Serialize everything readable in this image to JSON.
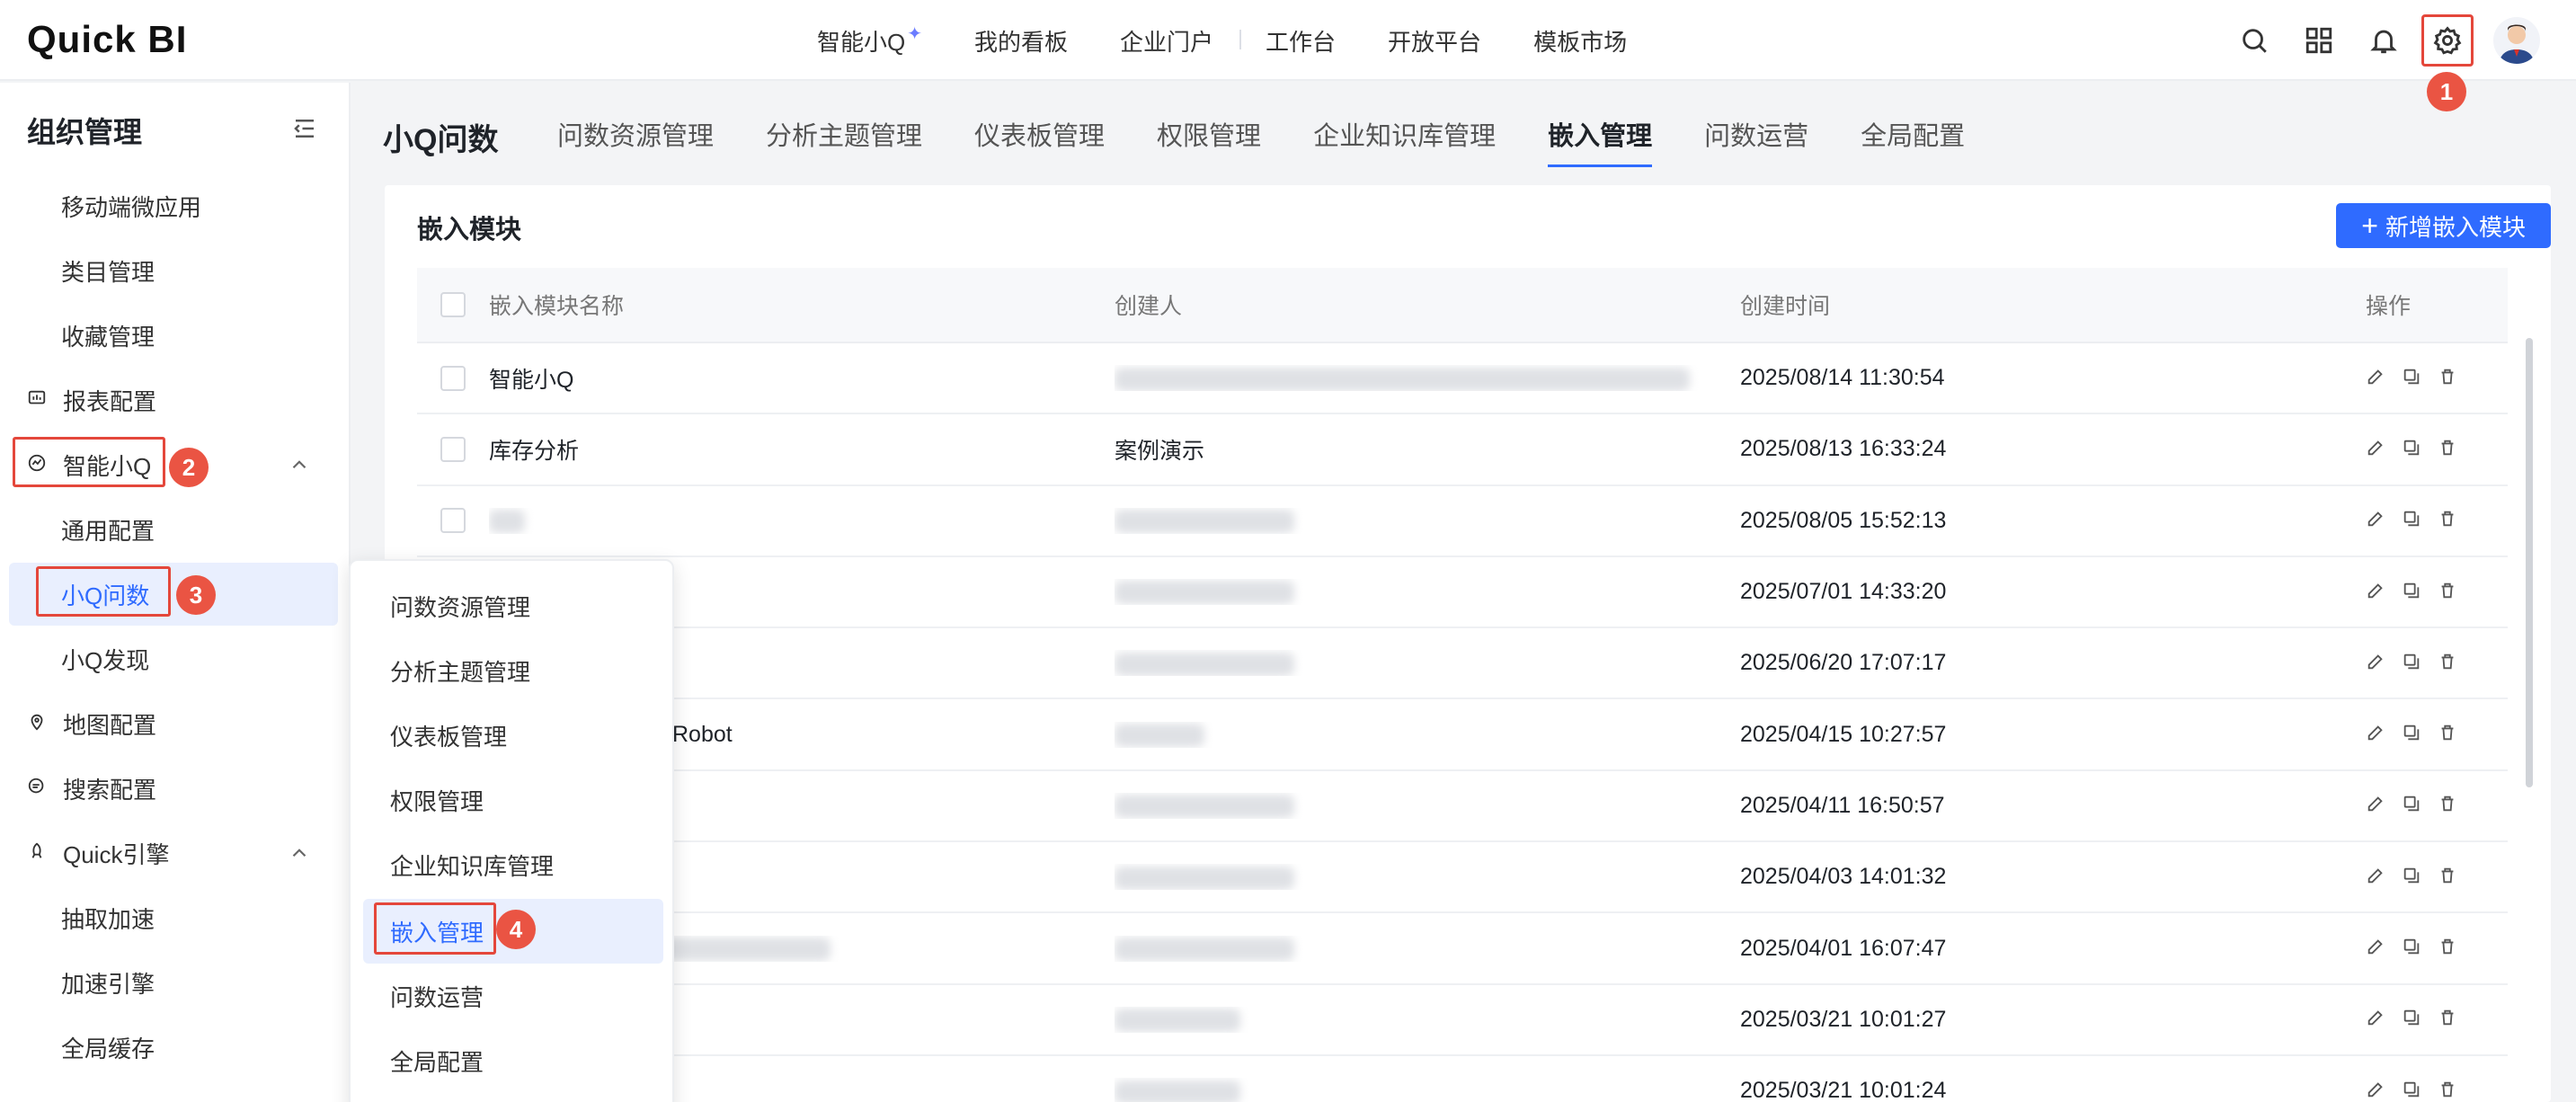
{
  "app": {
    "logo": "Quick BI"
  },
  "topnav": {
    "items": [
      "智能小Q",
      "我的看板",
      "企业门户",
      "工作台",
      "开放平台",
      "模板市场"
    ]
  },
  "badges": [
    "1",
    "2",
    "3",
    "4"
  ],
  "sidebar": {
    "title": "组织管理",
    "items": [
      {
        "label": "移动端微应用",
        "kind": "sub"
      },
      {
        "label": "类目管理",
        "kind": "sub"
      },
      {
        "label": "收藏管理",
        "kind": "sub"
      },
      {
        "label": "报表配置",
        "kind": "group",
        "icon": "report-icon"
      },
      {
        "label": "智能小Q",
        "kind": "group",
        "icon": "ai-icon",
        "expanded": true
      },
      {
        "label": "通用配置",
        "kind": "sub"
      },
      {
        "label": "小Q问数",
        "kind": "sub",
        "active": true
      },
      {
        "label": "小Q发现",
        "kind": "sub"
      },
      {
        "label": "地图配置",
        "kind": "group",
        "icon": "map-icon"
      },
      {
        "label": "搜索配置",
        "kind": "group",
        "icon": "search-config-icon"
      },
      {
        "label": "Quick引擎",
        "kind": "group",
        "icon": "engine-icon",
        "expanded": true
      },
      {
        "label": "抽取加速",
        "kind": "sub"
      },
      {
        "label": "加速引擎",
        "kind": "sub"
      },
      {
        "label": "全局缓存",
        "kind": "sub"
      }
    ]
  },
  "header": {
    "title": "小Q问数",
    "tabs": [
      "问数资源管理",
      "分析主题管理",
      "仪表板管理",
      "权限管理",
      "企业知识库管理",
      "嵌入管理",
      "问数运营",
      "全局配置"
    ],
    "active_tab": "嵌入管理"
  },
  "panel": {
    "title": "嵌入模块",
    "add_button": "新增嵌入模块",
    "columns": {
      "name": "嵌入模块名称",
      "creator": "创建人",
      "time": "创建时间",
      "ops": "操作"
    },
    "rows": [
      {
        "name": "智能小Q",
        "creator": "",
        "creator_blurred": true,
        "time": "2025/08/14 11:30:54"
      },
      {
        "name": "库存分析",
        "creator": "案例演示",
        "creator_blurred": false,
        "time": "2025/08/13 16:33:24"
      },
      {
        "name": "",
        "name_blurred": true,
        "creator": "",
        "creator_blurred": true,
        "time": "2025/08/05 15:52:13"
      },
      {
        "name": "",
        "creator": "",
        "creator_blurred": true,
        "time": "2025/07/01 14:33:20"
      },
      {
        "name": "",
        "creator": "",
        "creator_blurred": true,
        "time": "2025/06/20 17:07:17"
      },
      {
        "name": "Robot",
        "creator": "",
        "creator_blurred": true,
        "time": "2025/04/15 10:27:57"
      },
      {
        "name": "",
        "creator": "",
        "creator_blurred": true,
        "time": "2025/04/11 16:50:57"
      },
      {
        "name": "",
        "creator": "",
        "creator_blurred": true,
        "time": "2025/04/03 14:01:32"
      },
      {
        "name": "",
        "name_blurred": true,
        "creator": "",
        "creator_blurred": true,
        "time": "2025/04/01 16:07:47"
      },
      {
        "name": "",
        "creator": "",
        "creator_blurred": true,
        "time": "2025/03/21 10:01:27"
      },
      {
        "name": "",
        "creator": "",
        "creator_blurred": true,
        "time": "2025/03/21 10:01:24"
      }
    ]
  },
  "popup_menu": {
    "items": [
      "问数资源管理",
      "分析主题管理",
      "仪表板管理",
      "权限管理",
      "企业知识库管理",
      "嵌入管理",
      "问数运营",
      "全局配置"
    ],
    "active": "嵌入管理"
  },
  "colors": {
    "accent": "#2f6bff",
    "highlight": "#e4473b",
    "badge": "#ea5443"
  }
}
